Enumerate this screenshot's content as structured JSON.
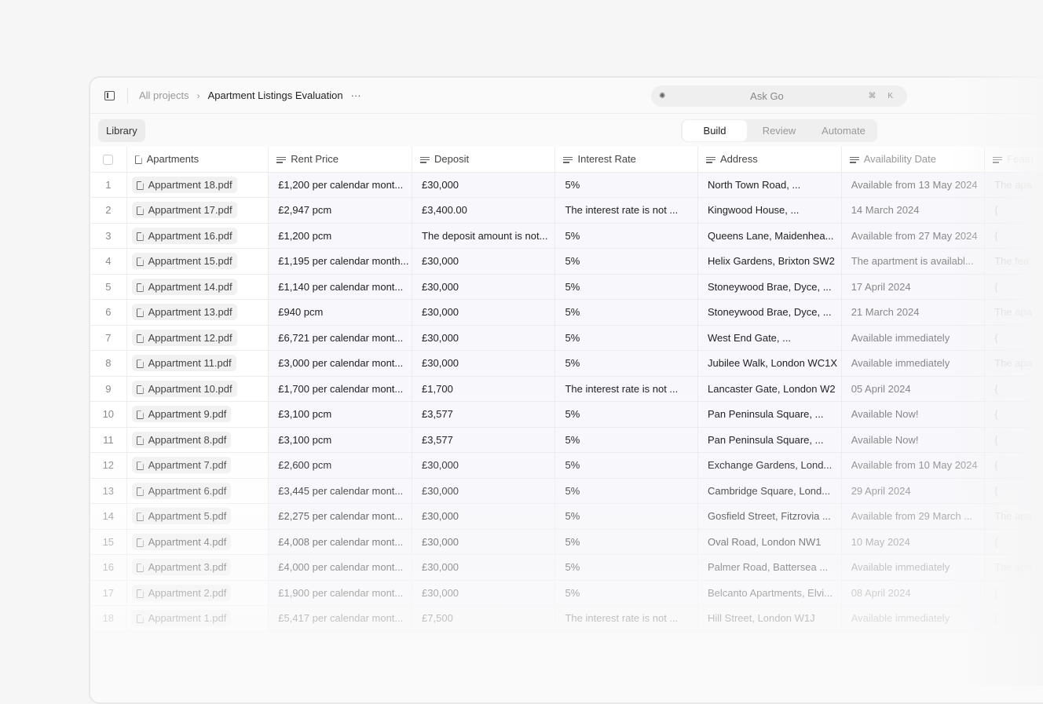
{
  "header": {
    "breadcrumb_root": "All projects",
    "title": "Apartment Listings Evaluation",
    "more": "···",
    "ask_label": "Ask Go",
    "ask_shortcut": "⌘ K"
  },
  "toolbar": {
    "library": "Library",
    "tabs": [
      {
        "label": "Build",
        "active": true
      },
      {
        "label": "Review"
      },
      {
        "label": "Automate"
      }
    ]
  },
  "table": {
    "columns": [
      "Apartments",
      "Rent Price",
      "Deposit",
      "Interest Rate",
      "Address",
      "Availability Date",
      "Featu"
    ],
    "rows": [
      [
        "1",
        "Appartment 18.pdf",
        "£1,200 per calendar mont...",
        "£30,000",
        "5%",
        "North Town Road, ...",
        "Available from 13 May 2024",
        "The apa"
      ],
      [
        "2",
        "Appartment 17.pdf",
        "£2,947 pcm",
        "£3,400.00",
        "The interest rate is not ...",
        "Kingwood House, ...",
        "14 March 2024",
        "{"
      ],
      [
        "3",
        "Appartment 16.pdf",
        "£1,200 pcm",
        "The deposit amount is not...",
        "5%",
        "Queens Lane, Maidenhea...",
        "Available from 27 May 2024",
        "{"
      ],
      [
        "4",
        "Appartment 15.pdf",
        "£1,195 per calendar month...",
        "£30,000",
        "5%",
        "Helix Gardens, Brixton SW2",
        "The apartment is availabl...",
        "The fea"
      ],
      [
        "5",
        "Appartment 14.pdf",
        "£1,140 per calendar mont...",
        "£30,000",
        "5%",
        "Stoneywood Brae, Dyce, ...",
        "17 April 2024",
        "{"
      ],
      [
        "6",
        "Appartment 13.pdf",
        "£940 pcm",
        "£30,000",
        "5%",
        "Stoneywood Brae, Dyce, ...",
        "21 March 2024",
        "The apa"
      ],
      [
        "7",
        "Appartment 12.pdf",
        "£6,721 per calendar mont...",
        "£30,000",
        "5%",
        "West End Gate, ...",
        "Available immediately",
        "{"
      ],
      [
        "8",
        "Appartment 11.pdf",
        "£3,000 per calendar mont...",
        "£30,000",
        "5%",
        "Jubilee Walk, London WC1X",
        "Available immediately",
        "The apa"
      ],
      [
        "9",
        "Appartment 10.pdf",
        "£1,700 per calendar mont...",
        "£1,700",
        "The interest rate is not ...",
        "Lancaster Gate, London W2",
        "05 April 2024",
        "{"
      ],
      [
        "10",
        "Appartment 9.pdf",
        "£3,100 pcm",
        "£3,577",
        "5%",
        "Pan Peninsula Square, ...",
        "Available Now!",
        "{"
      ],
      [
        "11",
        "Appartment 8.pdf",
        "£3,100 pcm",
        "£3,577",
        "5%",
        "Pan Peninsula Square, ...",
        "Available Now!",
        "{"
      ],
      [
        "12",
        "Appartment 7.pdf",
        "£2,600 pcm",
        "£30,000",
        "5%",
        "Exchange Gardens, Lond...",
        "Available from 10 May 2024",
        "{"
      ],
      [
        "13",
        "Appartment 6.pdf",
        "£3,445 per calendar mont...",
        "£30,000",
        "5%",
        "Cambridge Square, Lond...",
        "29 April 2024",
        "{"
      ],
      [
        "14",
        "Appartment 5.pdf",
        "£2,275 per calendar mont...",
        "£30,000",
        "5%",
        "Gosfield Street, Fitzrovia ...",
        "Available from 29 March ...",
        "The apa"
      ],
      [
        "15",
        "Appartment 4.pdf",
        "£4,008 per calendar mont...",
        "£30,000",
        "5%",
        "Oval Road, London NW1",
        "10 May 2024",
        "{"
      ],
      [
        "16",
        "Appartment 3.pdf",
        "£4,000 per calendar mont...",
        "£30,000",
        "5%",
        "Palmer Road, Battersea ...",
        "Available immediately",
        "The apa"
      ],
      [
        "17",
        "Appartment 2.pdf",
        "£1,900 per calendar mont...",
        "£30,000",
        "5%",
        "Belcanto Apartments, Elvi...",
        "08 April 2024",
        "{"
      ],
      [
        "18",
        "Appartment 1.pdf",
        "£5,417 per calendar mont...",
        "£7,500",
        "The interest rate is not ...",
        "Hill Street, London W1J",
        "Available immediately",
        "{"
      ]
    ]
  }
}
